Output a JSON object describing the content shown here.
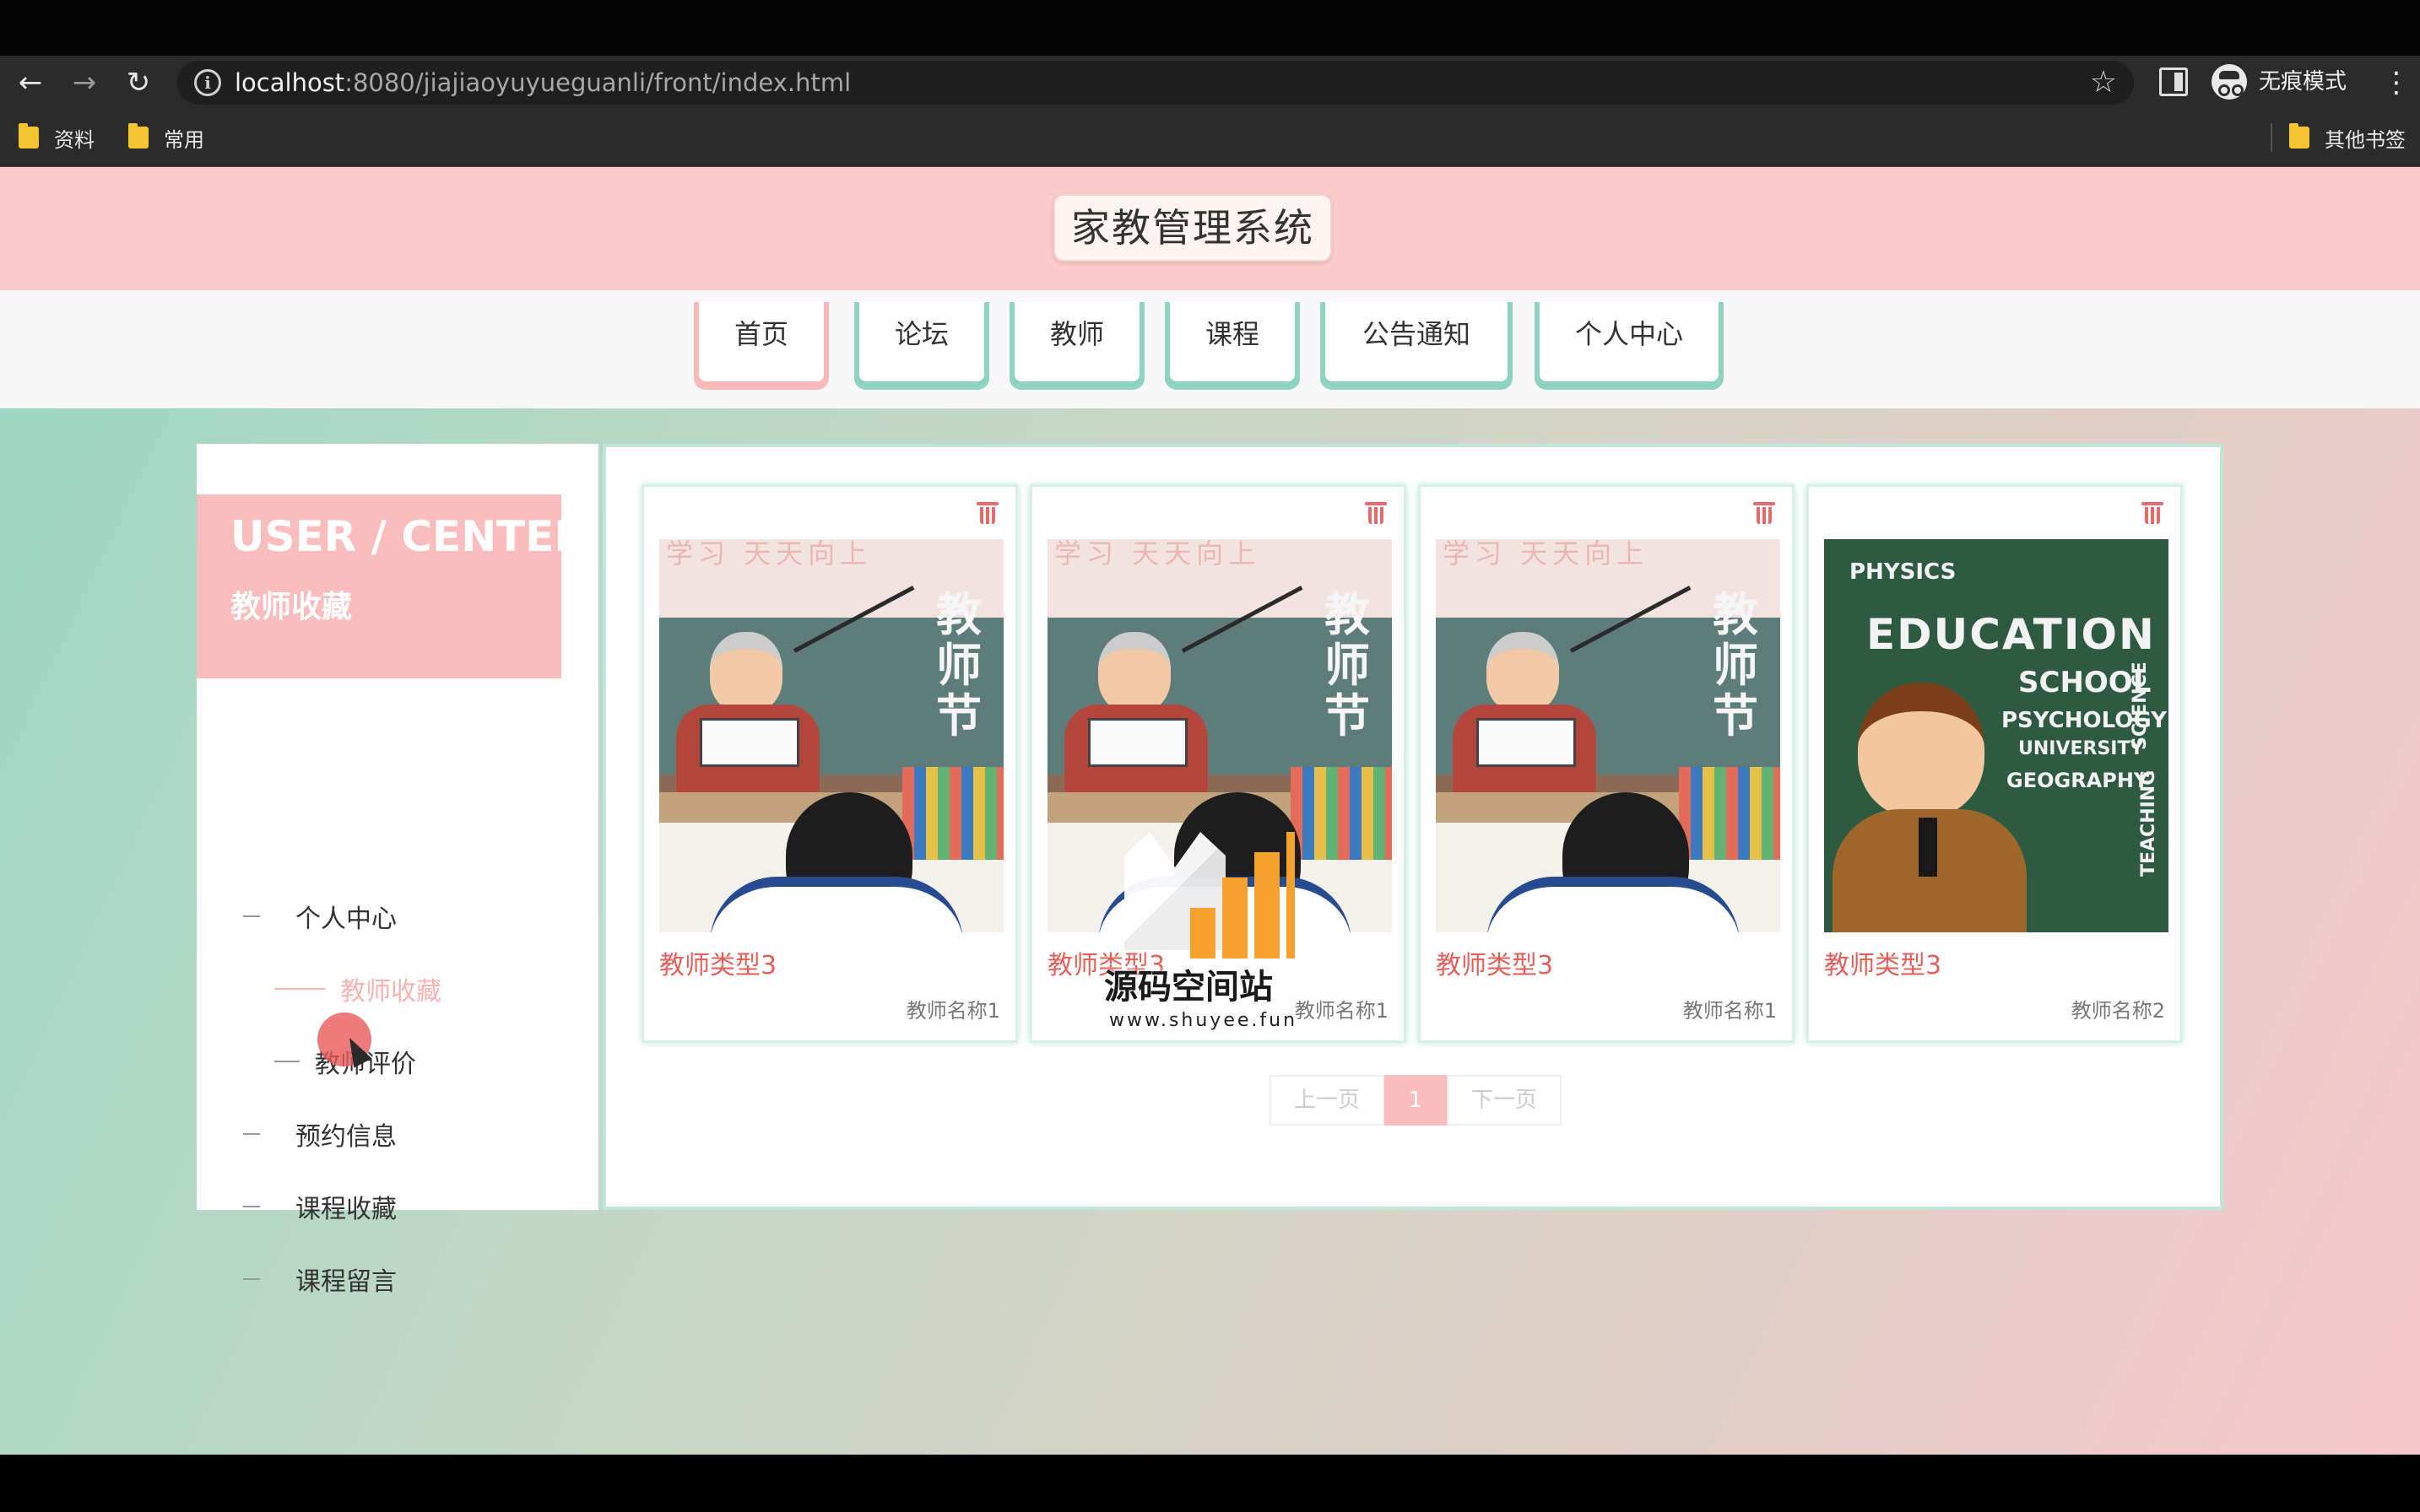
{
  "browser": {
    "url_host": "localhost",
    "url_rest": ":8080/jiajiaoyuyueguanli/front/index.html",
    "incognito_label": "无痕模式",
    "bookmarks": [
      "资料",
      "常用"
    ],
    "other_bookmarks": "其他书签"
  },
  "site": {
    "title": "家教管理系统",
    "nav": [
      "首页",
      "论坛",
      "教师",
      "课程",
      "公告通知",
      "个人中心"
    ]
  },
  "sidebar": {
    "heading": "USER / CENTER",
    "subheading": "教师收藏",
    "items": [
      "个人中心",
      "教师收藏",
      "教师评价",
      "预约信息",
      "课程收藏",
      "课程留言"
    ]
  },
  "cards": [
    {
      "type": "教师类型3",
      "name": "教师名称1",
      "image": "teacher-day-classroom",
      "banner": "学习  天天向上",
      "board": "教师节"
    },
    {
      "type": "教师类型3",
      "name": "教师名称1",
      "image": "teacher-day-classroom",
      "banner": "学习  天天向上",
      "board": "教师节"
    },
    {
      "type": "教师类型3",
      "name": "教师名称1",
      "image": "teacher-day-classroom",
      "banner": "学习  天天向上",
      "board": "教师节"
    },
    {
      "type": "教师类型3",
      "name": "教师名称2",
      "image": "education-chalkboard",
      "words": [
        "PHYSICS",
        "EDUCATION",
        "SCHOOL",
        "PSYCHOLOGY",
        "UNIVERSITY",
        "GEOGRAPHY",
        "SCIENCE",
        "TEACHING"
      ]
    }
  ],
  "pagination": {
    "prev": "上一页",
    "current": "1",
    "next": "下一页"
  },
  "watermark": {
    "name": "源码空间站",
    "url": "www.shuyee.fun"
  },
  "icons": {
    "card_action": "trash-icon"
  },
  "colors": {
    "header_pink": "#fbcaca",
    "nav_teal": "#8ed2c0",
    "accent_red": "#e4605b"
  }
}
